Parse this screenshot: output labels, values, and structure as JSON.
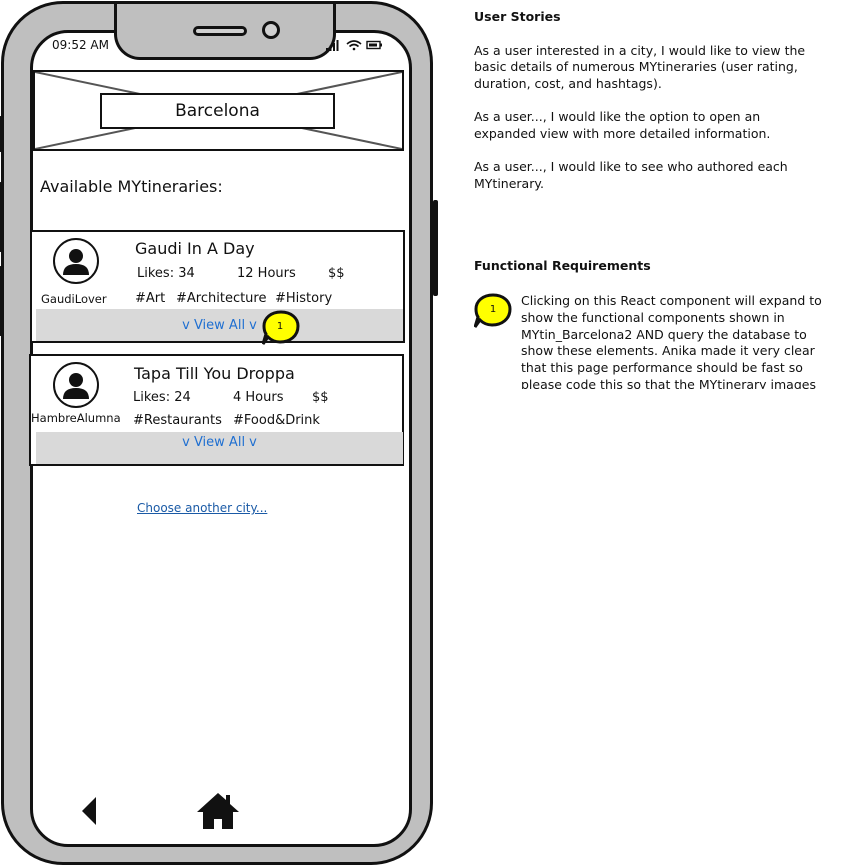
{
  "status_bar": {
    "time": "09:52 AM"
  },
  "header": {
    "city": "Barcelona"
  },
  "section_title": "Available MYtineraries:",
  "itineraries": [
    {
      "title": "Gaudi In A Day",
      "author": "GaudiLover",
      "likes": "Likes: 34",
      "duration": "12 Hours",
      "cost": "$$",
      "tags": [
        "#Art",
        "#Architecture",
        "#History"
      ],
      "view_all": "v View All v"
    },
    {
      "title": "Tapa Till You Droppa",
      "author": "HambreAlumna",
      "likes": "Likes: 24",
      "duration": "4 Hours",
      "cost": "$$",
      "tags": [
        "#Restaurants",
        "#Food&Drink"
      ],
      "view_all": "v View All v"
    }
  ],
  "marker_label": "1",
  "choose_link": "Choose another city...",
  "notes": {
    "user_stories_title": "User Stories",
    "stories": [
      "As a user interested in a city, I would like to view the basic details of numerous MYtineraries (user rating, duration, cost, and hashtags).",
      "As a user..., I would like the option to open an expanded view with more detailed information.",
      "As a user..., I would like to see who authored each MYtinerary."
    ],
    "functional_title": "Functional Requirements",
    "requirement_marker": "1",
    "requirement_text": "Clicking on this React component will expand to show the functional components shown in MYtin_Barcelona2 AND query the database to show these elements. Anika made it very clear that this page performance should be fast so please code this so that the MYtinerary images"
  },
  "colors": {
    "marker_yellow": "#ffff00",
    "link_blue": "#1f6fd1",
    "view_bar_gray": "#d9d9d9"
  },
  "icons": [
    "signal-icon",
    "wifi-icon",
    "battery-icon",
    "user-avatar-icon",
    "back-arrow-icon",
    "home-icon"
  ]
}
